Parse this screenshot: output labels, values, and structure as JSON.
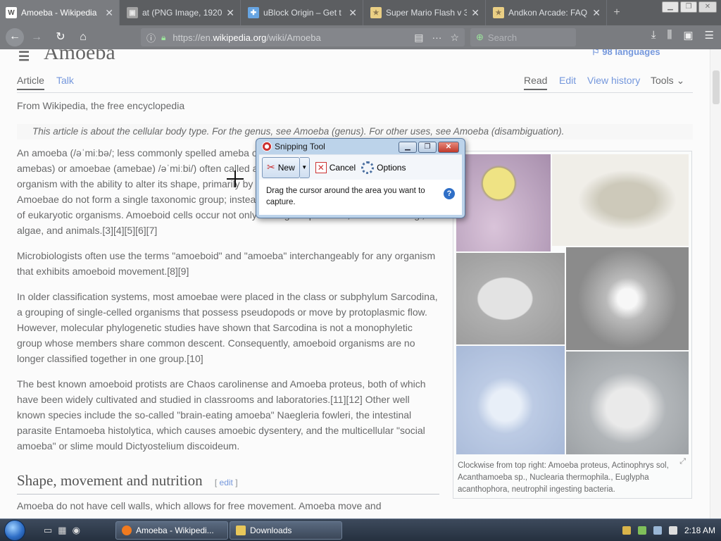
{
  "browser": {
    "tabs": [
      {
        "label": "Amoeba - Wikipedia",
        "icon": "W",
        "active": true
      },
      {
        "label": "at (PNG Image, 1920",
        "icon": "img",
        "active": false
      },
      {
        "label": "uBlock Origin – Get t",
        "icon": "puzzle",
        "active": false
      },
      {
        "label": "Super Mario Flash v 3",
        "icon": "star",
        "active": false
      },
      {
        "label": "Andkon Arcade: FAQ",
        "icon": "star",
        "active": false
      }
    ],
    "url_prefix": "https://en.",
    "url_domain": "wikipedia.org",
    "url_path": "/wiki/Amoeba",
    "search_placeholder": "Search"
  },
  "article": {
    "title": "Amoeba",
    "languages": "98 languages",
    "tabs": {
      "article": "Article",
      "talk": "Talk",
      "read": "Read",
      "edit": "Edit",
      "view_history": "View history",
      "tools": "Tools"
    },
    "from": "From Wikipedia, the free encyclopedia",
    "hatnote": "This article is about the cellular body type. For the genus, see Amoeba (genus). For other uses, see Amoeba (disambiguation).",
    "p1": "An amoeba (/əˈmiːbə/; less commonly spelled ameba or amœba; pl.: amoebas (less commonly, amebas) or amoebae (amebae) /əˈmiːbi/) often called an amoeboid, is a type of cell or unicellular organism with the ability to alter its shape, primarily by extending and retracting pseudopods.[2] Amoebae do not form a single taxonomic group; instead, they are found in every major lineage of eukaryotic organisms. Amoeboid cells occur not only among the protozoa, but also in fungi, algae, and animals.[3][4][5][6][7]",
    "p2": "Microbiologists often use the terms \"amoeboid\" and \"amoeba\" interchangeably for any organism that exhibits amoeboid movement.[8][9]",
    "p3": "In older classification systems, most amoebae were placed in the class or subphylum Sarcodina, a grouping of single-celled organisms that possess pseudopods or move by protoplasmic flow. However, molecular phylogenetic studies have shown that Sarcodina is not a monophyletic group whose members share common descent. Consequently, amoeboid organisms are no longer classified together in one group.[10]",
    "p4": "The best known amoeboid protists are Chaos carolinense and Amoeba proteus, both of which have been widely cultivated and studied in classrooms and laboratories.[11][12] Other well known species include the so-called \"brain-eating amoeba\" Naegleria fowleri, the intestinal parasite Entamoeba histolytica, which causes amoebic dysentery, and the multicellular \"social amoeba\" or slime mould Dictyostelium discoideum.",
    "section_heading": "Shape, movement and nutrition",
    "section_edit": "edit",
    "last_line": "Amoeba do not have cell walls, which allows for free movement. Amoeba move and",
    "caption": "Clockwise from top right: Amoeba proteus, Actinophrys sol, Acanthamoeba sp., Nuclearia thermophila., Euglypha acanthophora, neutrophil ingesting bacteria."
  },
  "snipping_tool": {
    "title": "Snipping Tool",
    "new_label": "New",
    "cancel_label": "Cancel",
    "options_label": "Options",
    "message": "Drag the cursor around the area you want to capture."
  },
  "taskbar": {
    "items": [
      {
        "label": "Amoeba - Wikipedi..."
      },
      {
        "label": "Downloads"
      }
    ],
    "time": "2:18 AM"
  }
}
